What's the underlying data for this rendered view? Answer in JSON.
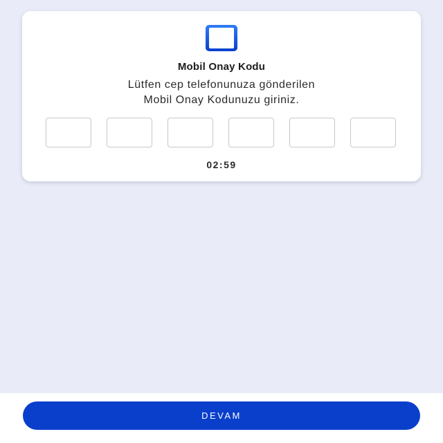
{
  "card": {
    "icon": "smartphone-icon",
    "title": "Mobil Onay Kodu",
    "description_line1": "Lütfen cep telefonunuza gönderilen",
    "description_line2": "Mobil Onay Kodunuzu giriniz.",
    "code_digits": [
      "",
      "",
      "",
      "",
      "",
      ""
    ],
    "timer": "02:59"
  },
  "footer": {
    "continue_label": "DEVAM"
  },
  "colors": {
    "background": "#e9ebf8",
    "card": "#ffffff",
    "accent": "#0a3fcc",
    "icon_gradient_top": "#2f7df6",
    "icon_gradient_bottom": "#0a3fcc"
  }
}
